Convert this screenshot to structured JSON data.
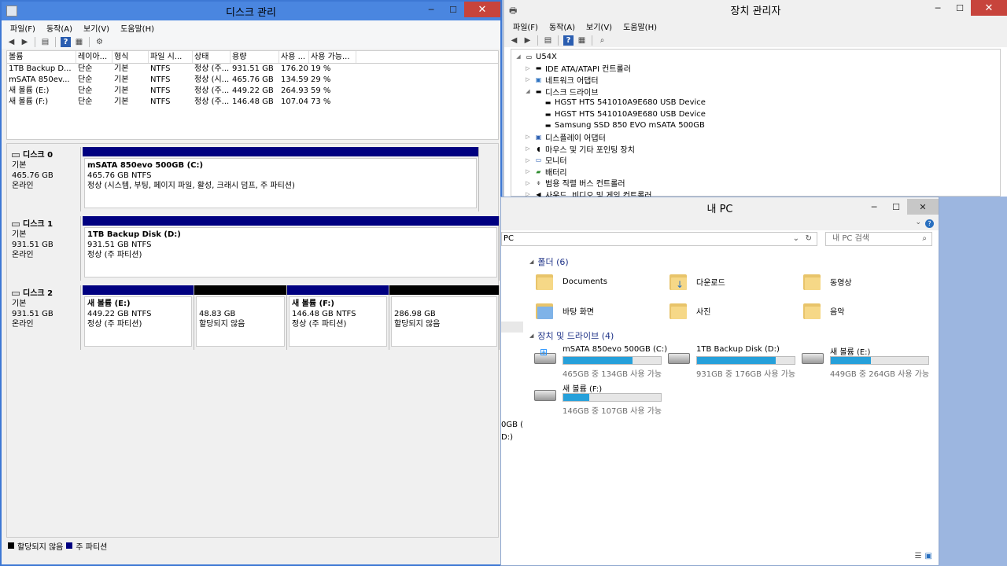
{
  "disk_mgmt": {
    "title": "디스크 관리",
    "menu": [
      "파일(F)",
      "동작(A)",
      "보기(V)",
      "도움말(H)"
    ],
    "columns": [
      "볼륨",
      "레이아...",
      "형식",
      "파일 시...",
      "상태",
      "용량",
      "사용 ...",
      "사용 가능..."
    ],
    "rows": [
      [
        "1TB Backup D...",
        "단순",
        "기본",
        "NTFS",
        "정상 (주...",
        "931.51 GB",
        "176.20...",
        "19 %"
      ],
      [
        "mSATA 850ev...",
        "단순",
        "기본",
        "NTFS",
        "정상 (시...",
        "465.76 GB",
        "134.59...",
        "29 %"
      ],
      [
        "새 볼륨 (E:)",
        "단순",
        "기본",
        "NTFS",
        "정상 (주...",
        "449.22 GB",
        "264.93...",
        "59 %"
      ],
      [
        "새 볼륨 (F:)",
        "단순",
        "기본",
        "NTFS",
        "정상 (주...",
        "146.48 GB",
        "107.04...",
        "73 %"
      ]
    ],
    "disks": [
      {
        "name": "디스크 0",
        "type": "기본",
        "size": "465.76 GB",
        "status": "온라인",
        "parts": [
          {
            "title": "mSATA 850evo 500GB  (C:)",
            "line2": "465.76 GB NTFS",
            "line3": "정상 (시스템, 부팅, 페이지 파일, 활성, 크래시 덤프, 주 파티션)"
          }
        ]
      },
      {
        "name": "디스크 1",
        "type": "기본",
        "size": "931.51 GB",
        "status": "온라인",
        "parts": [
          {
            "title": "1TB Backup Disk  (D:)",
            "line2": "931.51 GB NTFS",
            "line3": "정상 (주 파티션)"
          }
        ]
      },
      {
        "name": "디스크 2",
        "type": "기본",
        "size": "931.51 GB",
        "status": "온라인",
        "parts": [
          {
            "title": "새 볼륨  (E:)",
            "line2": "449.22 GB NTFS",
            "line3": "정상 (주 파티션)"
          },
          {
            "title": "",
            "line2": "48.83 GB",
            "line3": "할당되지 않음"
          },
          {
            "title": "새 볼륨  (F:)",
            "line2": "146.48 GB NTFS",
            "line3": "정상 (주 파티션)"
          },
          {
            "title": "",
            "line2": "286.98 GB",
            "line3": "할당되지 않음"
          }
        ]
      }
    ],
    "legend": [
      "할당되지 않음",
      "주 파티션"
    ]
  },
  "device_mgr": {
    "title": "장치 관리자",
    "menu": [
      "파일(F)",
      "동작(A)",
      "보기(V)",
      "도움말(H)"
    ],
    "tree": [
      {
        "label": "U54X",
        "level": 0,
        "arrow": "◢",
        "icon": "computer-icon"
      },
      {
        "label": "IDE ATA/ATAPI 컨트롤러",
        "level": 1,
        "arrow": "▷",
        "icon": "ide-controller-icon"
      },
      {
        "label": "네트워크 어댑터",
        "level": 1,
        "arrow": "▷",
        "icon": "network-icon"
      },
      {
        "label": "디스크 드라이브",
        "level": 1,
        "arrow": "◢",
        "icon": "disk-drive-icon"
      },
      {
        "label": "HGST HTS 541010A9E680 USB Device",
        "level": 2,
        "arrow": "",
        "icon": "disk-drive-icon"
      },
      {
        "label": "HGST HTS 541010A9E680 USB Device",
        "level": 2,
        "arrow": "",
        "icon": "disk-drive-icon"
      },
      {
        "label": "Samsung SSD 850 EVO mSATA 500GB",
        "level": 2,
        "arrow": "",
        "icon": "disk-drive-icon"
      },
      {
        "label": "디스플레이 어댑터",
        "level": 1,
        "arrow": "▷",
        "icon": "display-icon"
      },
      {
        "label": "마우스 및 기타 포인팅 장치",
        "level": 1,
        "arrow": "▷",
        "icon": "mouse-icon"
      },
      {
        "label": "모니터",
        "level": 1,
        "arrow": "▷",
        "icon": "monitor-icon"
      },
      {
        "label": "배터리",
        "level": 1,
        "arrow": "▷",
        "icon": "battery-icon"
      },
      {
        "label": "범용 직렬 버스 컨트롤러",
        "level": 1,
        "arrow": "▷",
        "icon": "usb-icon"
      },
      {
        "label": "사운드, 비디오 및 게임 컨트롤러",
        "level": 1,
        "arrow": "▷",
        "icon": "sound-icon"
      }
    ]
  },
  "explorer": {
    "title": "내 PC",
    "address": "PC",
    "search_placeholder": "내 PC 검색",
    "folders_header": "폴더 (6)",
    "folders": [
      "Documents",
      "다운로드",
      "동영상",
      "바탕 화면",
      "사진",
      "음악"
    ],
    "drives_header": "장치 및 드라이브 (4)",
    "drives": [
      {
        "name": "mSATA 850evo 500GB (C:)",
        "sub": "465GB 중 134GB 사용 가능",
        "used_pct": 71
      },
      {
        "name": "1TB Backup Disk (D:)",
        "sub": "931GB 중 176GB 사용 가능",
        "used_pct": 81
      },
      {
        "name": "새 볼륨 (E:)",
        "sub": "449GB 중 264GB 사용 가능",
        "used_pct": 41
      },
      {
        "name": "새 볼륨 (F:)",
        "sub": "146GB 중 107GB 사용 가능",
        "used_pct": 27
      }
    ],
    "left_fragments": [
      "0GB (",
      "D:)"
    ]
  }
}
